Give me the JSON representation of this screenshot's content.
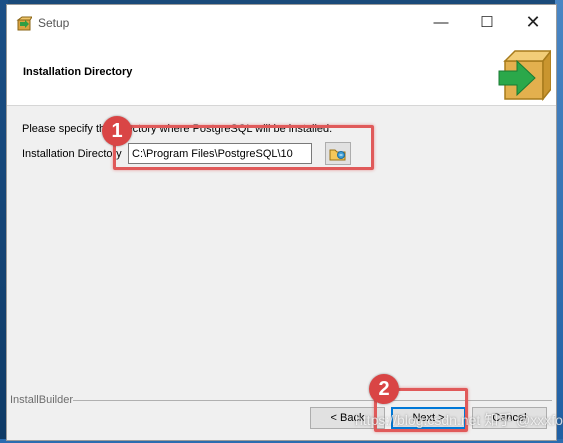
{
  "window": {
    "title": "Setup",
    "controls": {
      "minimize": "—",
      "maximize": "☐",
      "close": "✕"
    }
  },
  "header": {
    "title": "Installation Directory"
  },
  "body": {
    "instruction": "Please specify the directory where PostgreSQL will be installed.",
    "dir_label": "Installation Directory",
    "dir_value": "C:\\Program Files\\PostgreSQL\\10"
  },
  "footer": {
    "brand": "InstallBuilder",
    "back_label": "< Back",
    "next_label": "Next >",
    "cancel_label": "Cancel"
  },
  "annotations": {
    "badge1": "1",
    "badge2": "2",
    "accent_color": "#e05a5a"
  },
  "watermark": "https://blog.csdn.net 知乎 @xxxfor"
}
